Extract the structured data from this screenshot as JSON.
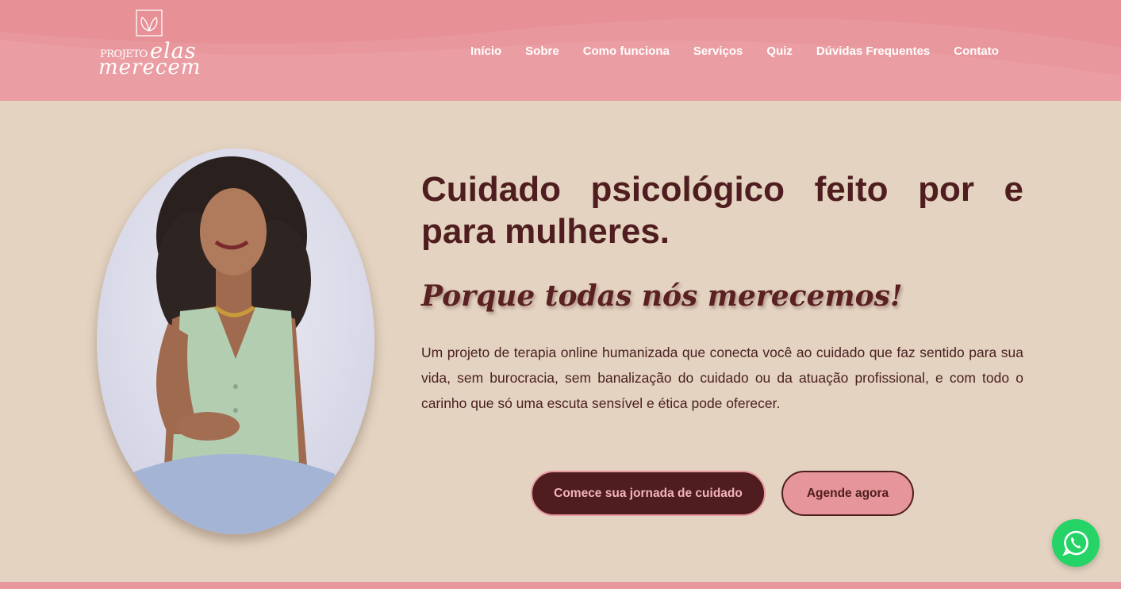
{
  "brand": {
    "logo_projeto": "PROJETO",
    "logo_elas": "elas",
    "logo_merecem": "merecem"
  },
  "nav": {
    "items": [
      {
        "label": "Início"
      },
      {
        "label": "Sobre"
      },
      {
        "label": "Como funciona"
      },
      {
        "label": "Serviços"
      },
      {
        "label": "Quiz"
      },
      {
        "label": "Dúvidas Frequentes"
      },
      {
        "label": "Contato"
      }
    ]
  },
  "hero": {
    "title": "Cuidado psicológico feito por e para mulheres.",
    "subtitle": "Porque todas nós merecemos!",
    "text": "Um projeto de terapia online humanizada que conecta você ao cuidado que faz sentido para sua vida, sem burocracia, sem banalização do cuidado ou da atuação profissional, e com todo o carinho que só uma escuta sensível e ética pode oferecer.",
    "primary_button": "Comece sua jornada de cuidado",
    "secondary_button": "Agende agora"
  },
  "icons": {
    "whatsapp": "whatsapp-icon",
    "logo_mark": "butterfly-logo-icon"
  },
  "colors": {
    "header": "#e8979c",
    "background": "#e3d3c0",
    "primary": "#4f1d1f",
    "whatsapp": "#25d366"
  }
}
